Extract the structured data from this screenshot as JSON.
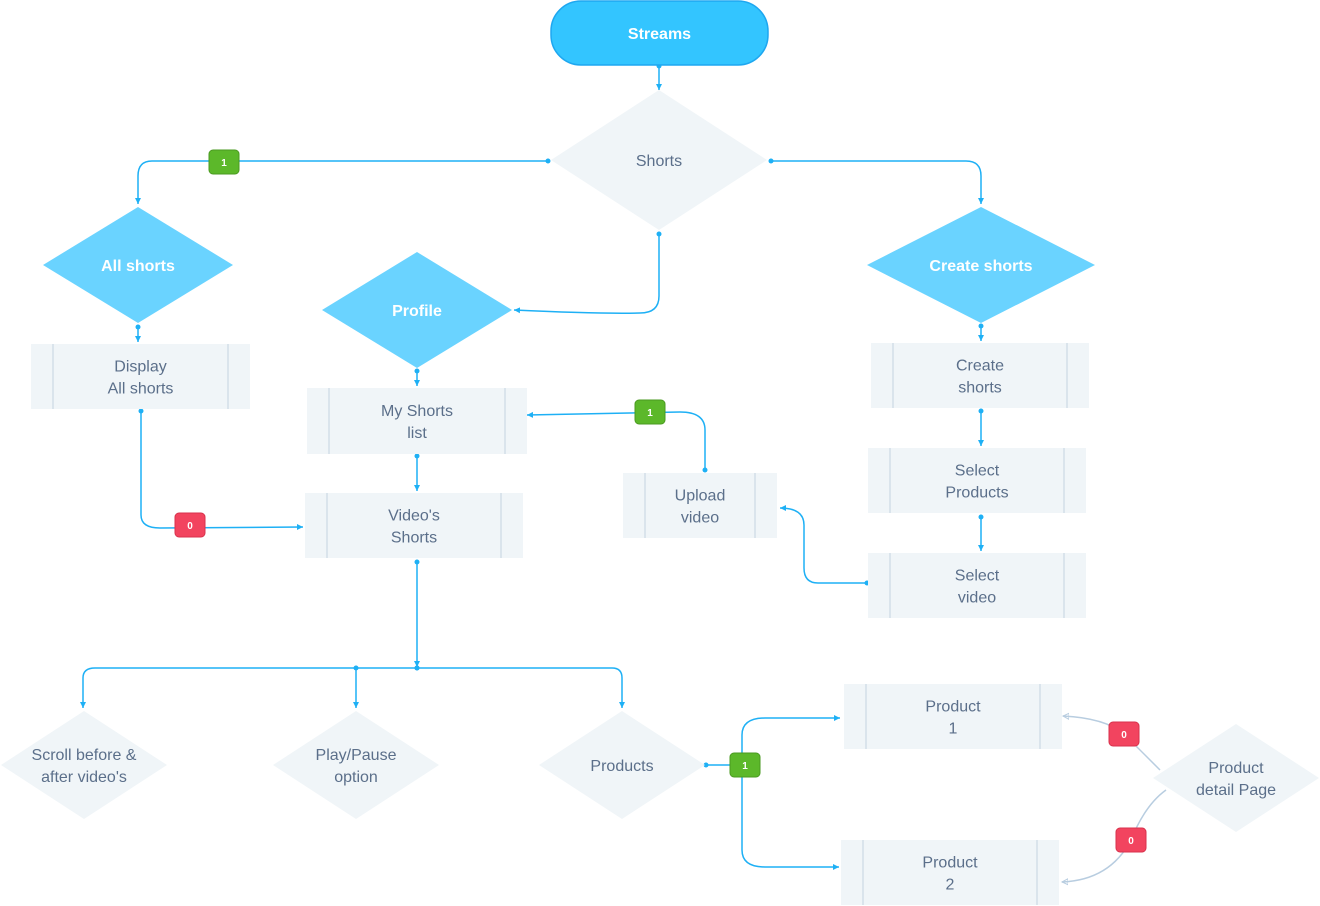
{
  "colors": {
    "terminal_fill": "#33c5ff",
    "decision_primary_fill": "#6ad3ff",
    "node_fill": "#f0f5f8",
    "node_text": "#5b6f8a",
    "edge": "#1eb0f5",
    "edge_muted": "#b8cde0",
    "badge_yes": "#5cb82a",
    "badge_no": "#f2445f"
  },
  "nodes": {
    "streams": {
      "label": [
        "Streams"
      ],
      "shape": "terminal"
    },
    "shorts": {
      "label": [
        "Shorts"
      ],
      "shape": "decision"
    },
    "all_shorts": {
      "label": [
        "All shorts"
      ],
      "shape": "decision-primary"
    },
    "profile": {
      "label": [
        "Profile"
      ],
      "shape": "decision-primary"
    },
    "create_shorts_decision": {
      "label": [
        "Create shorts"
      ],
      "shape": "decision-primary"
    },
    "display_all_shorts": {
      "label": [
        "Display",
        "All shorts"
      ],
      "shape": "process"
    },
    "my_shorts_list": {
      "label": [
        "My Shorts",
        "list"
      ],
      "shape": "process"
    },
    "videos_shorts": {
      "label": [
        "Video's",
        "Shorts"
      ],
      "shape": "process"
    },
    "upload_video": {
      "label": [
        "Upload",
        "video"
      ],
      "shape": "process"
    },
    "create_shorts": {
      "label": [
        "Create",
        "shorts"
      ],
      "shape": "process"
    },
    "select_products": {
      "label": [
        "Select",
        "Products"
      ],
      "shape": "process"
    },
    "select_video": {
      "label": [
        "Select",
        "video"
      ],
      "shape": "process"
    },
    "product_1": {
      "label": [
        "Product",
        "1"
      ],
      "shape": "process"
    },
    "product_2": {
      "label": [
        "Product",
        "2"
      ],
      "shape": "process"
    },
    "scroll": {
      "label": [
        "Scroll before &",
        "after video's"
      ],
      "shape": "decision"
    },
    "play_pause": {
      "label": [
        "Play/Pause",
        "option"
      ],
      "shape": "decision"
    },
    "products": {
      "label": [
        "Products"
      ],
      "shape": "decision"
    },
    "product_detail": {
      "label": [
        "Product",
        "detail Page"
      ],
      "shape": "decision"
    }
  },
  "badges": [
    {
      "text": "1",
      "type": "yes"
    },
    {
      "text": "1",
      "type": "yes"
    },
    {
      "text": "1",
      "type": "yes"
    },
    {
      "text": "0",
      "type": "no"
    },
    {
      "text": "0",
      "type": "no"
    },
    {
      "text": "0",
      "type": "no"
    }
  ]
}
